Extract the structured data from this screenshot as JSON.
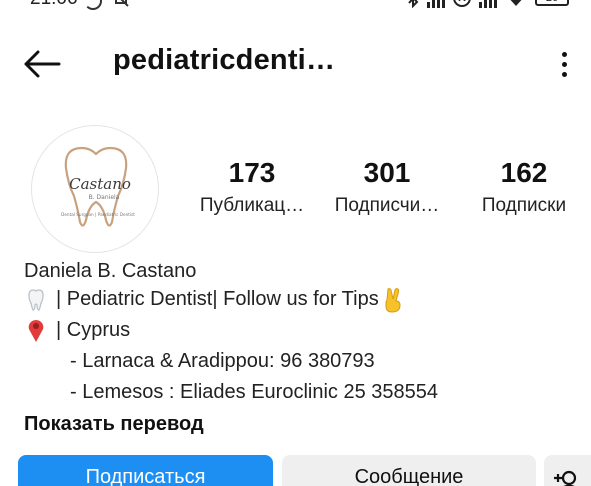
{
  "status_bar": {
    "time": "21:06",
    "battery": "26",
    "icons": [
      "moon-icon",
      "muted-bell-icon",
      "bluetooth-icon",
      "signal-icon",
      "roaming-icon",
      "signal-icon",
      "wifi-icon",
      "battery-icon"
    ]
  },
  "header": {
    "title": "pediatricdenti…",
    "back_icon": "back-arrow-icon",
    "more_icon": "more-vertical-icon"
  },
  "profile": {
    "avatar": {
      "logo_text": "Castano",
      "logo_subtext": "B. Daniela",
      "logo_tagline": "Dental Surgeon | Paediatric Dentist"
    },
    "stats": [
      {
        "value": "173",
        "label": "Публикац…"
      },
      {
        "value": "301",
        "label": "Подписчи…"
      },
      {
        "value": "162",
        "label": "Подписки"
      }
    ]
  },
  "bio": {
    "name": "Daniela B. Castano",
    "line1_icon": "tooth-icon",
    "line1_text": "| Pediatric Dentist| Follow us for Tips",
    "line1_emoji_icon": "victory-hand-icon",
    "line2_icon": "location-pin-icon",
    "line2_text": "| Cyprus",
    "line3_text": "- Larnaca & Aradippou: 96 380793",
    "line4_text": "- Lemesos : Eliades Euroclinic 25 358554",
    "translate_link": "Показать перевод"
  },
  "actions": {
    "follow_label": "Подписаться",
    "message_label": "Сообщение",
    "add_icon": "add-person-icon"
  },
  "colors": {
    "follow_button": "#1e8ff2",
    "secondary_button": "#efefef",
    "text": "#111111",
    "logo_accent": "#c8a27e"
  }
}
